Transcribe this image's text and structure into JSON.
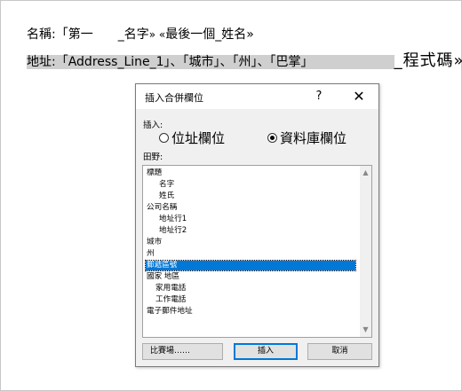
{
  "document": {
    "line1": {
      "label": "名稱:",
      "field1": "「第一　　_名字",
      "sep": "»  «",
      "field2": "最後一個_姓名»"
    },
    "line2": {
      "label": "地址:",
      "fields": "「Address_Line_1」、「城市」、「州」、「巴掌」",
      "blank": "　　　　　　　",
      "tail": "_程式碼»"
    }
  },
  "dialog": {
    "title": "插入合併欄位",
    "help": "?",
    "close": "✕",
    "insert_label": "插入:",
    "radio_address": "位址欄位",
    "radio_database": "資料庫欄位",
    "radio_selected": "database",
    "fields_label": "田野:",
    "fields": [
      {
        "label": "標題",
        "indent": 0
      },
      {
        "label": "名字",
        "indent": 2
      },
      {
        "label": "姓氏",
        "indent": 2
      },
      {
        "label": "公司名稱",
        "indent": 0
      },
      {
        "label": "地址行1",
        "indent": 2
      },
      {
        "label": "地址行2",
        "indent": 2
      },
      {
        "label": "城市",
        "indent": 0
      },
      {
        "label": "州",
        "indent": 0
      },
      {
        "label": "郵遞區號",
        "indent": 0,
        "selected": true
      },
      {
        "label": "國家 地區",
        "indent": 0
      },
      {
        "label": "家用電話",
        "indent": 1
      },
      {
        "label": "工作電話",
        "indent": 1
      },
      {
        "label": "電子郵件地址",
        "indent": 0
      }
    ],
    "btn_match": "比賽場……",
    "btn_insert": "插入",
    "btn_cancel": "取消",
    "accent": "#0078d7"
  }
}
